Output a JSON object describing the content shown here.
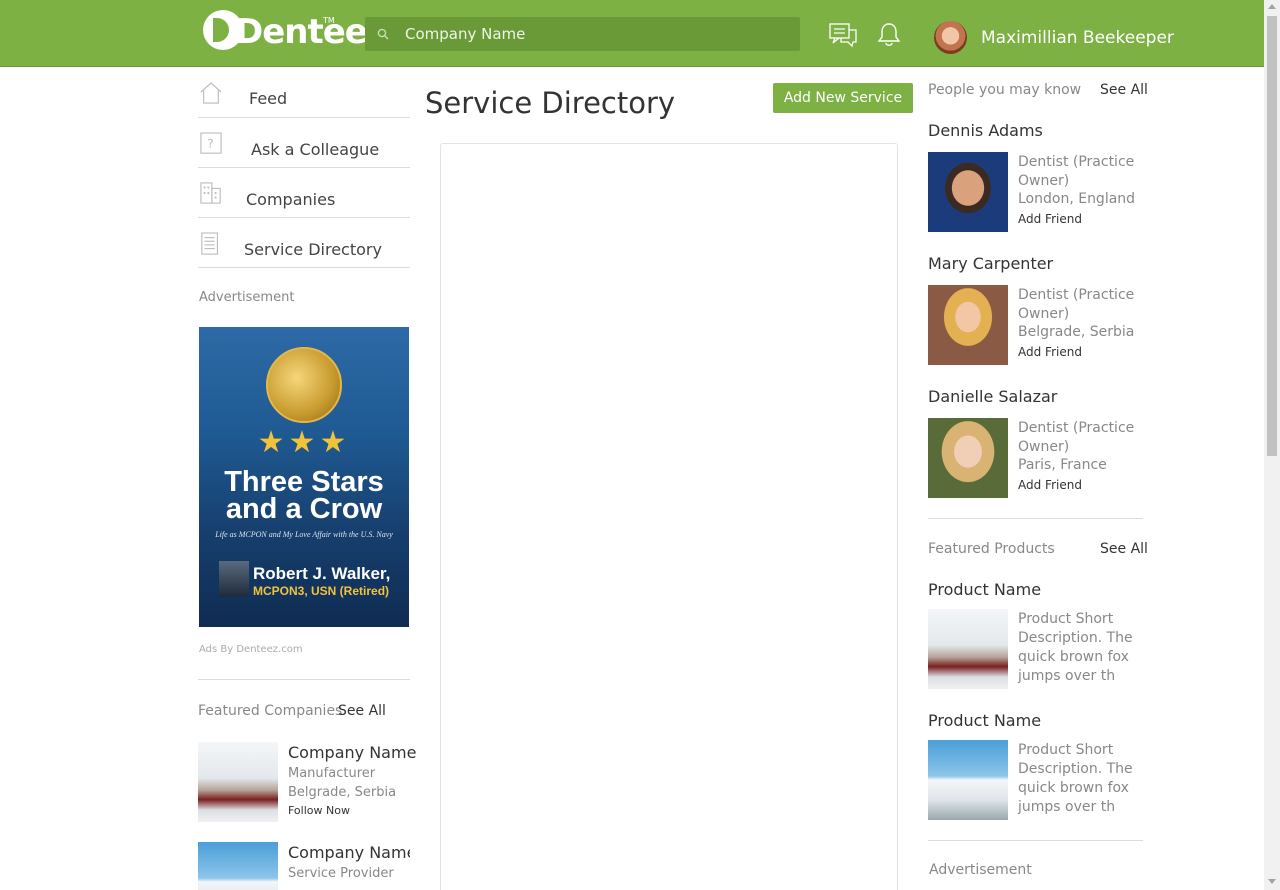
{
  "header": {
    "logo_text": "Denteez",
    "logo_tm": "TM",
    "search_placeholder": "Company Name",
    "icons": [
      "chat-icon",
      "bell-icon",
      "search-icon"
    ],
    "user_name": "Maximillian Beekeeper",
    "bg_color": "#7db143"
  },
  "sidebar": {
    "items": [
      {
        "label": "Feed",
        "icon": "home-icon"
      },
      {
        "label": "Ask a Colleague",
        "icon": "question-icon"
      },
      {
        "label": "Companies",
        "icon": "building-icon"
      },
      {
        "label": "Service Directory",
        "icon": "document-icon"
      }
    ],
    "ad_label": "Advertisement",
    "ad": {
      "title": "Three Stars and a Crow",
      "subtitle": "Life as MCPON and My Love Affair with the U.S. Navy",
      "author": "Robert J. Walker,",
      "rank": "MCPON3, USN (Retired)"
    },
    "ads_by": "Ads By Denteez.com",
    "featured_companies": {
      "title": "Featured Companies",
      "see_all": "See All",
      "items": [
        {
          "name": "Company Name",
          "type": "Manufacturer",
          "location": "Belgrade, Serbia",
          "action": "Follow Now"
        },
        {
          "name": "Company Name",
          "type": "Service Provider"
        }
      ]
    }
  },
  "main": {
    "title": "Service Directory",
    "add_button": "Add New Service"
  },
  "right": {
    "people": {
      "title": "People you may know",
      "see_all": "See All",
      "items": [
        {
          "name": "Dennis Adams",
          "role": "Dentist (Practice Owner)",
          "location": "London, England",
          "action": "Add Friend"
        },
        {
          "name": "Mary Carpenter",
          "role": "Dentist (Practice Owner)",
          "location": "Belgrade, Serbia",
          "action": "Add Friend"
        },
        {
          "name": "Danielle Salazar",
          "role": "Dentist (Practice Owner)",
          "location": "Paris, France",
          "action": "Add Friend"
        }
      ]
    },
    "products": {
      "title": "Featured Products",
      "see_all": "See All",
      "items": [
        {
          "name": "Product Name",
          "description": "Product Short Description. The quick brown fox jumps over th"
        },
        {
          "name": "Product Name",
          "description": "Product Short Description. The quick brown fox jumps over th"
        }
      ]
    },
    "ad_label": "Advertisement"
  }
}
